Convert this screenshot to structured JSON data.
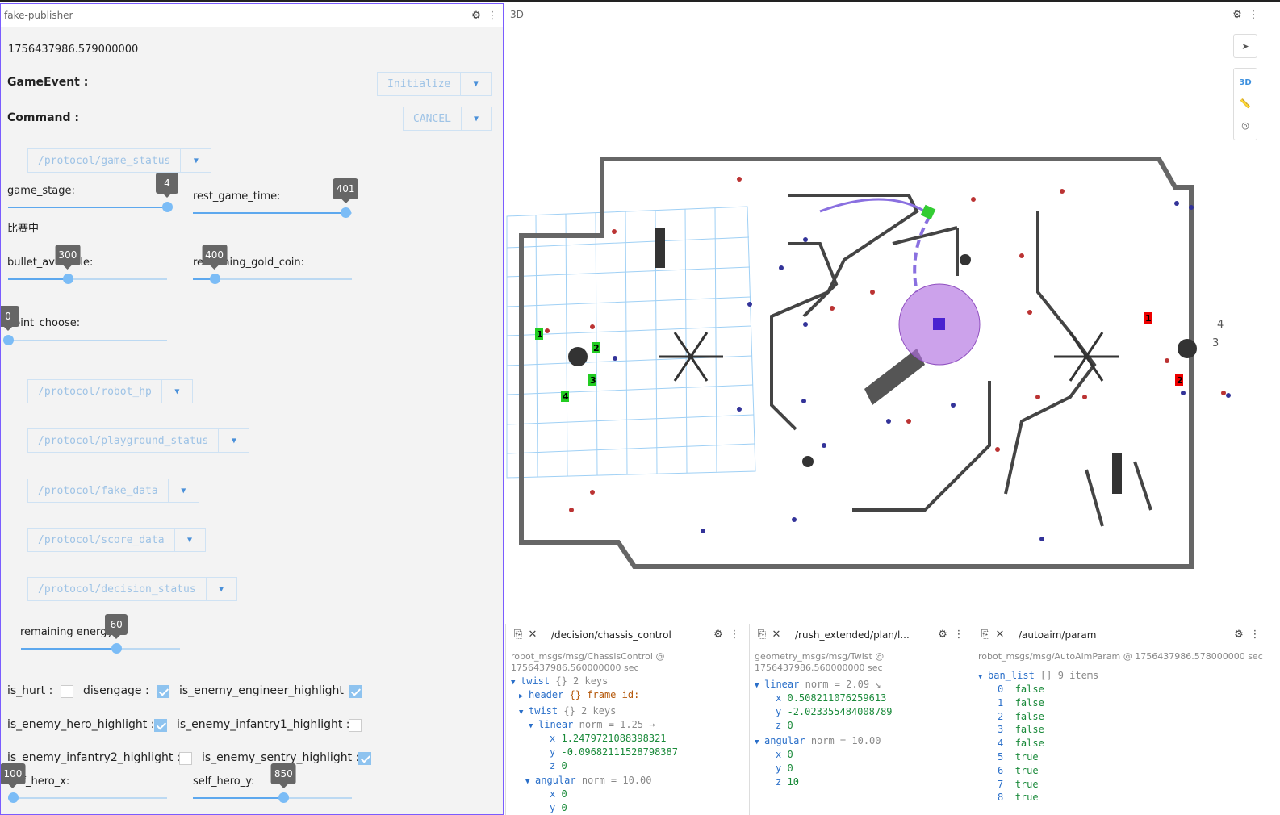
{
  "left": {
    "title": "fake-publisher",
    "timestamp": "1756437986.579000000",
    "game_event_label": "GameEvent :",
    "game_event_value": "Initialize",
    "command_label": "Command :",
    "command_value": "CANCEL",
    "topics": [
      "/protocol/game_status",
      "/protocol/robot_hp",
      "/protocol/playground_status",
      "/protocol/fake_data",
      "/protocol/score_data",
      "/protocol/decision_status"
    ],
    "game_stage_label": "game_stage:",
    "game_stage_value": "4",
    "rest_time_label": "rest_game_time:",
    "rest_time_value": "401",
    "status_text": "比赛中",
    "bullet_label": "bullet_available:",
    "bullet_value": "300",
    "gold_label": "remaining_gold_coin:",
    "gold_value": "400",
    "point_label": "point_choose:",
    "point_value": "0",
    "energy_label": "remaining energy:",
    "energy_value": "60",
    "checks": {
      "is_hurt": "is_hurt :",
      "disengage": "disengage :",
      "engineer": "is_enemy_engineer_highlight :",
      "hero": "is_enemy_hero_highlight :",
      "inf1": "is_enemy_infantry1_highlight :",
      "inf2": "is_enemy_infantry2_highlight :",
      "sentry": "is_enemy_sentry_highlight :"
    },
    "self_hero_x_label": "self_hero_x:",
    "self_hero_x_value": "100",
    "self_hero_y_label": "self_hero_y:",
    "self_hero_y_value": "850"
  },
  "three": {
    "title": "3D",
    "mode": "3D"
  },
  "p1": {
    "topic": "/decision/chassis_control",
    "type": "robot_msgs/msg/ChassisControl @",
    "time": "1756437986.560000000 sec",
    "twist": "twist",
    "twist_n": "{} 2 keys",
    "header": "header",
    "header_n": "{} frame_id:",
    "twist2": "twist",
    "twist2_n": "{} 2 keys",
    "linear": "linear",
    "linear_n": "norm = 1.25 →",
    "lx": "1.2479721088398321",
    "ly": "-0.09682111528798387",
    "lz": "0",
    "angular": "angular",
    "angular_n": "norm = 10.00",
    "ax": "0",
    "ay": "0"
  },
  "p2": {
    "topic": "/rush_extended/plan/l...",
    "type": "geometry_msgs/msg/Twist @",
    "time": "1756437986.560000000 sec",
    "linear": "linear",
    "linear_n": "norm = 2.09 ↘",
    "lx": "0.508211076259613",
    "ly": "-2.023355484008789",
    "lz": "0",
    "angular": "angular",
    "angular_n": "norm = 10.00",
    "ax": "0",
    "ay": "0",
    "az": "10"
  },
  "p3": {
    "topic": "/autoaim/param",
    "type": "robot_msgs/msg/AutoAimParam @ 1756437986.578000000 sec",
    "ban": "ban_list",
    "ban_n": "[] 9 items",
    "items": [
      [
        "0",
        "false"
      ],
      [
        "1",
        "false"
      ],
      [
        "2",
        "false"
      ],
      [
        "3",
        "false"
      ],
      [
        "4",
        "false"
      ],
      [
        "5",
        "true"
      ],
      [
        "6",
        "true"
      ],
      [
        "7",
        "true"
      ],
      [
        "8",
        "true"
      ]
    ]
  },
  "colors": {
    "accent": "#5da8ee",
    "purple": "#7a5cff"
  }
}
